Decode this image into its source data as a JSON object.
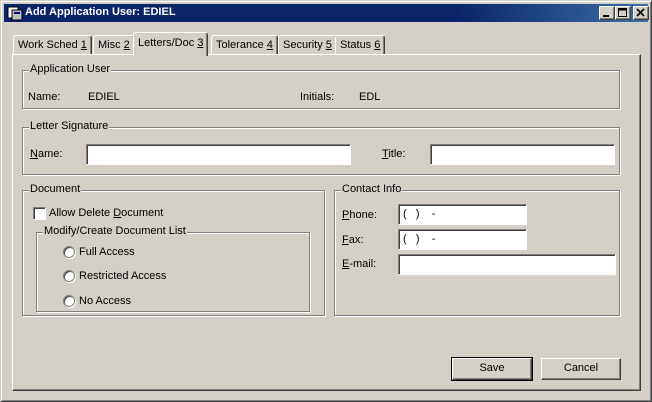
{
  "window": {
    "title": "Add Application User: EDIEL"
  },
  "tabs": [
    {
      "label": "Work Sched ",
      "key": "1"
    },
    {
      "label": "Misc ",
      "key": "2"
    },
    {
      "label": "Letters/Doc ",
      "key": "3"
    },
    {
      "label": "Tolerance ",
      "key": "4"
    },
    {
      "label": "Security ",
      "key": "5"
    },
    {
      "label": "Status ",
      "key": "6"
    }
  ],
  "application_user": {
    "group_label": "Application User",
    "name_label": "Name:",
    "name_value": "EDIEL",
    "initials_label": "Initials:",
    "initials_value": "EDL"
  },
  "letter_signature": {
    "group_label": "Letter Signature",
    "name_label_key": "N",
    "name_label_rest": "ame:",
    "name_value": "",
    "title_label_key": "T",
    "title_label_rest": "itle:",
    "title_value": ""
  },
  "document": {
    "group_label": "Document",
    "allow_delete_pre": "Allow Delete ",
    "allow_delete_key": "D",
    "allow_delete_post": "ocument",
    "modify_group_label": "Modify/Create Document List",
    "options": [
      "Full Access",
      "Restricted Access",
      "No Access"
    ]
  },
  "contact_info": {
    "group_label": "Contact Info",
    "phone_label_key": "P",
    "phone_label_rest": "hone:",
    "phone_value": "(   )    -",
    "fax_label_key": "F",
    "fax_label_rest": "ax:",
    "fax_value": "(   )    -",
    "email_label_key": "E",
    "email_label_rest": "-mail:",
    "email_value": ""
  },
  "buttons": {
    "save": "Save",
    "cancel": "Cancel"
  }
}
